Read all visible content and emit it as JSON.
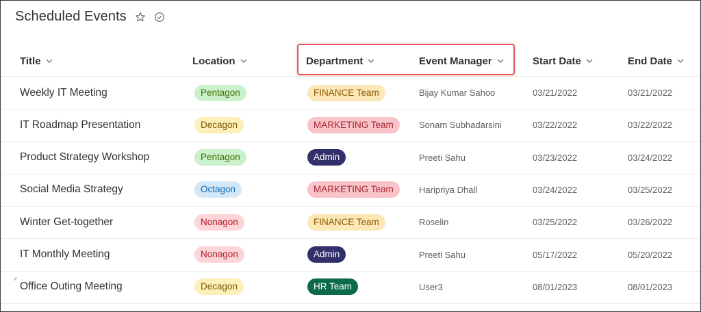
{
  "page": {
    "title": "Scheduled Events",
    "icons": [
      "star-icon",
      "check-circle-icon"
    ]
  },
  "columns": [
    {
      "key": "title",
      "label": "Title"
    },
    {
      "key": "location",
      "label": "Location"
    },
    {
      "key": "department",
      "label": "Department"
    },
    {
      "key": "manager",
      "label": "Event Manager"
    },
    {
      "key": "start",
      "label": "Start Date"
    },
    {
      "key": "end",
      "label": "End Date"
    }
  ],
  "pill_colors": {
    "Pentagon": {
      "bg": "#caf0cc",
      "fg": "#437406"
    },
    "Decagon": {
      "bg": "#fcefb9",
      "fg": "#7a5b00"
    },
    "Octagon": {
      "bg": "#d4e7f6",
      "fg": "#0f6ab5"
    },
    "Nonagon": {
      "bg": "#fdd4d8",
      "fg": "#b01c2d"
    },
    "FINANCE Team": {
      "bg": "#fce7b6",
      "fg": "#8a5a00"
    },
    "MARKETING Team": {
      "bg": "#f8c3c9",
      "fg": "#a4262c"
    },
    "Admin": {
      "bg": "#32306b",
      "fg": "#ffffff"
    },
    "HR Team": {
      "bg": "#0b6a4b",
      "fg": "#ffffff"
    }
  },
  "rows": [
    {
      "title": "Weekly IT Meeting",
      "location": "Pentagon",
      "department": "FINANCE Team",
      "manager": "Bijay Kumar Sahoo",
      "start": "03/21/2022",
      "end": "03/21/2022"
    },
    {
      "title": "IT Roadmap Presentation",
      "location": "Decagon",
      "department": "MARKETING Team",
      "manager": "Sonam Subhadarsini",
      "start": "03/22/2022",
      "end": "03/22/2022"
    },
    {
      "title": "Product Strategy Workshop",
      "location": "Pentagon",
      "department": "Admin",
      "manager": "Preeti Sahu",
      "start": "03/23/2022",
      "end": "03/24/2022"
    },
    {
      "title": "Social Media Strategy",
      "location": "Octagon",
      "department": "MARKETING Team",
      "manager": "Haripriya Dhall",
      "start": "03/24/2022",
      "end": "03/25/2022"
    },
    {
      "title": "Winter Get-together",
      "location": "Nonagon",
      "department": "FINANCE Team",
      "manager": "Roselin",
      "start": "03/25/2022",
      "end": "03/26/2022"
    },
    {
      "title": "IT Monthly Meeting",
      "location": "Nonagon",
      "department": "Admin",
      "manager": "Preeti Sahu",
      "start": "05/17/2022",
      "end": "05/20/2022"
    },
    {
      "title": "Office Outing Meeting",
      "location": "Decagon",
      "department": "HR Team",
      "manager": "User3",
      "start": "08/01/2023",
      "end": "08/01/2023"
    }
  ]
}
